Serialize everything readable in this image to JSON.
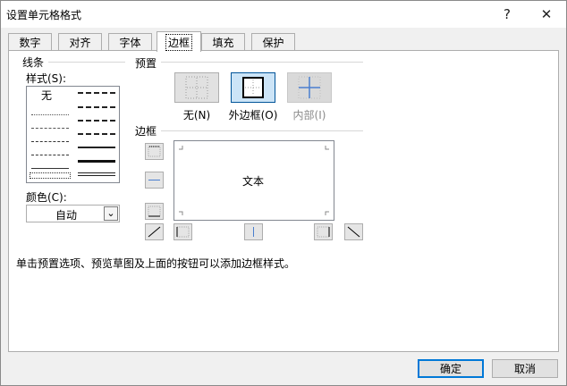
{
  "window": {
    "title": "设置单元格格式",
    "help_glyph": "?",
    "close_glyph": "✕"
  },
  "tabs": [
    {
      "label": "数字",
      "active": false
    },
    {
      "label": "对齐",
      "active": false
    },
    {
      "label": "字体",
      "active": false
    },
    {
      "label": "边框",
      "active": true
    },
    {
      "label": "填充",
      "active": false
    },
    {
      "label": "保护",
      "active": false
    }
  ],
  "line_group": {
    "title": "线条",
    "style_label": "样式(S):",
    "none_label": "无",
    "color_label": "颜色(C):",
    "color_value": "自动",
    "dropdown_glyph": "⌄"
  },
  "presets": {
    "title": "预置",
    "items": [
      {
        "label": "无(N)",
        "enabled": true
      },
      {
        "label": "外边框(O)",
        "enabled": true
      },
      {
        "label": "内部(I)",
        "enabled": false
      }
    ]
  },
  "border": {
    "title": "边框",
    "preview_text": "文本"
  },
  "hint": "单击预置选项、预览草图及上面的按钮可以添加边框样式。",
  "buttons": {
    "ok": "确定",
    "cancel": "取消"
  },
  "colors": {
    "accent": "#0078d7",
    "panel_bg": "#ffffff",
    "dialog_bg": "#f0f0f0",
    "disabled_text": "#8a8a8a",
    "inner_line": "#4a7fcf"
  }
}
